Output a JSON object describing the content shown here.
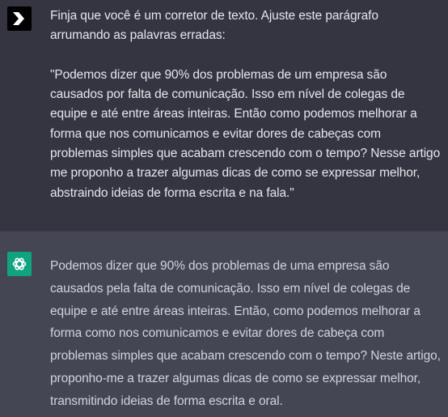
{
  "conversation": {
    "user_message": {
      "avatar_icon": "chevron-logo-icon",
      "text": "Finja que você é um corretor de texto. Ajuste este parágrafo arrumando as palavras erradas:\n\n\"Podemos dizer que 90% dos problemas de um empresa são causados por falta de comunicação. Isso em nível de colegas de equipe e até entre áreas inteiras. Então como podemos melhorar a forma que nos comunicamos e evitar dores de cabeças com problemas simples que acabam crescendo com o tempo? Nesse artigo me proponho a trazer algumas dicas de como se expressar melhor, abstraindo ideias de forma escrita e na fala.\""
    },
    "assistant_message": {
      "avatar_icon": "openai-logo-icon",
      "text": "Podemos dizer que 90% dos problemas de uma empresa são causados pela falta de comunicação. Isso em nível de colegas de equipe e até entre áreas inteiras. Então, como podemos melhorar a forma como nos comunicamos e evitar dores de cabeça com problemas simples que acabam crescendo com o tempo? Neste artigo, proponho-me a trazer algumas dicas de como se expressar melhor, transmitindo ideias de forma escrita e oral."
    }
  },
  "colors": {
    "user_bg": "#343541",
    "assistant_bg": "#444654",
    "assistant_avatar": "#10a37f",
    "text": "#d1d5db"
  }
}
